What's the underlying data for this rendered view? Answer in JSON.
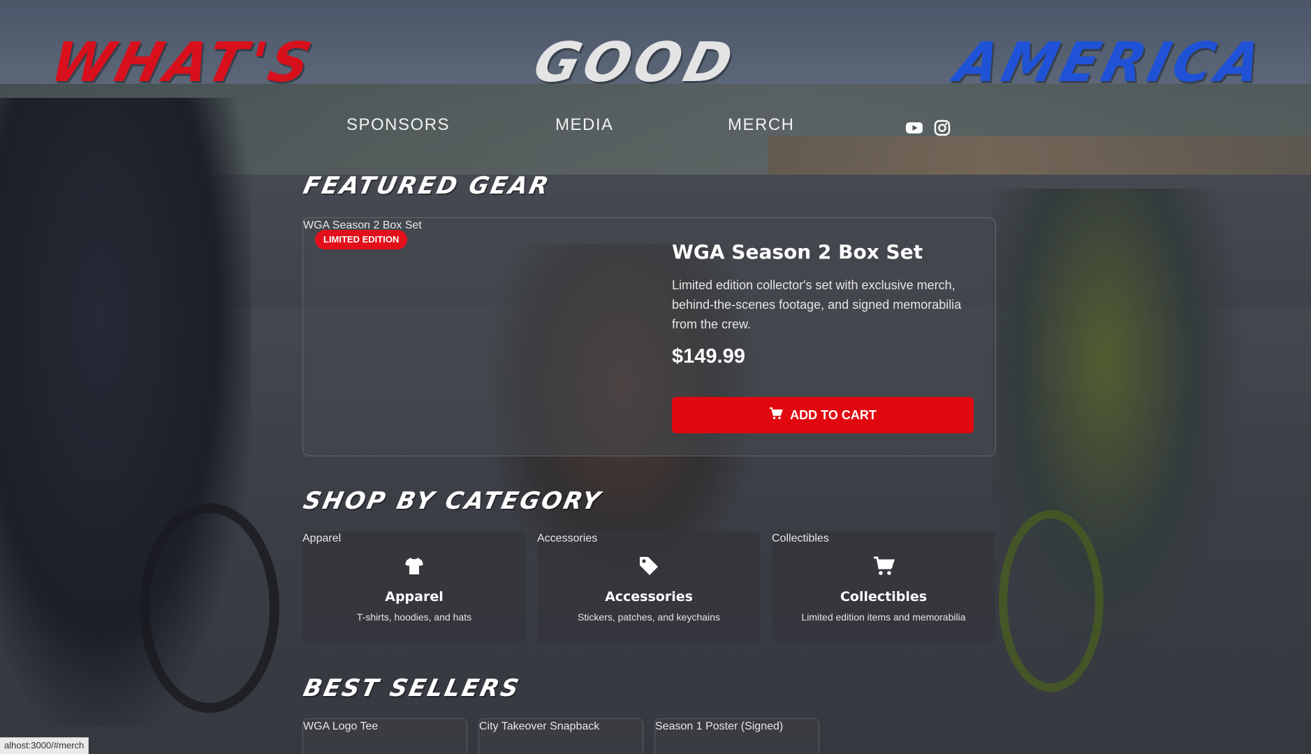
{
  "logo": {
    "part1": "WHAT'S",
    "part2": "GOOD",
    "part3": "AMERICA",
    "colors": {
      "part1": "#d8101c",
      "part2": "#e4e4e4",
      "part3": "#1f52d6"
    }
  },
  "nav": {
    "items": [
      "SPONSORS",
      "MEDIA",
      "MERCH"
    ],
    "social_icons": [
      "youtube-icon",
      "instagram-icon"
    ]
  },
  "featured": {
    "heading": "FEATURED GEAR",
    "image_alt": "WGA Season 2 Box Set",
    "badge": "LIMITED EDITION",
    "title": "WGA Season 2 Box Set",
    "description": "Limited edition collector's set with exclusive merch, behind-the-scenes footage, and signed memorabilia from the crew.",
    "price": "$149.99",
    "button_label": "ADD TO CART",
    "button_icon": "cart-icon",
    "accent_color": "#e2080f"
  },
  "categories": {
    "heading": "SHOP BY CATEGORY",
    "items": [
      {
        "image_alt": "Apparel",
        "icon": "tshirt-icon",
        "name": "Apparel",
        "description": "T-shirts, hoodies, and hats"
      },
      {
        "image_alt": "Accessories",
        "icon": "tag-icon",
        "name": "Accessories",
        "description": "Stickers, patches, and keychains"
      },
      {
        "image_alt": "Collectibles",
        "icon": "cart-icon",
        "name": "Collectibles",
        "description": "Limited edition items and memorabilia"
      }
    ]
  },
  "best_sellers": {
    "heading": "BEST SELLERS",
    "items": [
      {
        "image_alt": "WGA Logo Tee"
      },
      {
        "image_alt": "City Takeover Snapback"
      },
      {
        "image_alt": "Season 1 Poster (Signed)"
      }
    ]
  },
  "status_bar": {
    "url": "alhost:3000/#merch"
  }
}
